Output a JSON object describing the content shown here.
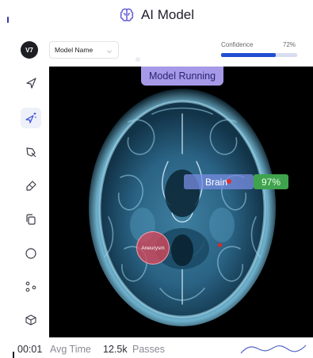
{
  "window": {
    "title": "AI Model",
    "title_icon": "brain-icon"
  },
  "toolbar": {
    "logo_text": "V7",
    "model_select_value": "Model Name",
    "confidence_label": "Confidence",
    "confidence_value": "72%",
    "confidence_fraction": 0.72
  },
  "tools": [
    {
      "name": "pointer-tool",
      "icon": "cursor-arrow-icon"
    },
    {
      "name": "auto-annotate-tool",
      "icon": "sparkle-cursor-icon",
      "active": true
    },
    {
      "name": "polygon-tool",
      "icon": "polygon-pen-icon"
    },
    {
      "name": "brush-tool",
      "icon": "brush-icon"
    },
    {
      "name": "copy-tool",
      "icon": "copy-icon"
    },
    {
      "name": "ellipse-tool",
      "icon": "circle-icon"
    },
    {
      "name": "keypoint-tool",
      "icon": "keypoints-icon"
    },
    {
      "name": "cuboid-tool",
      "icon": "cube-icon"
    }
  ],
  "viewer": {
    "status_pill": "Model Running",
    "brain_label": "Brain",
    "brain_confidence": "97%",
    "lesion_label": "Aneurysm"
  },
  "status": {
    "avg_time_value": "00:01",
    "avg_time_label": "Avg Time",
    "passes_value": "12.5k",
    "passes_label": "Passes"
  },
  "colors": {
    "accent": "#1f4fd1",
    "running_pill": "#a69ae8",
    "brain_tag": "#7a8ce0",
    "confidence_tag": "#3fa34d",
    "lesion": "#d7465a"
  }
}
